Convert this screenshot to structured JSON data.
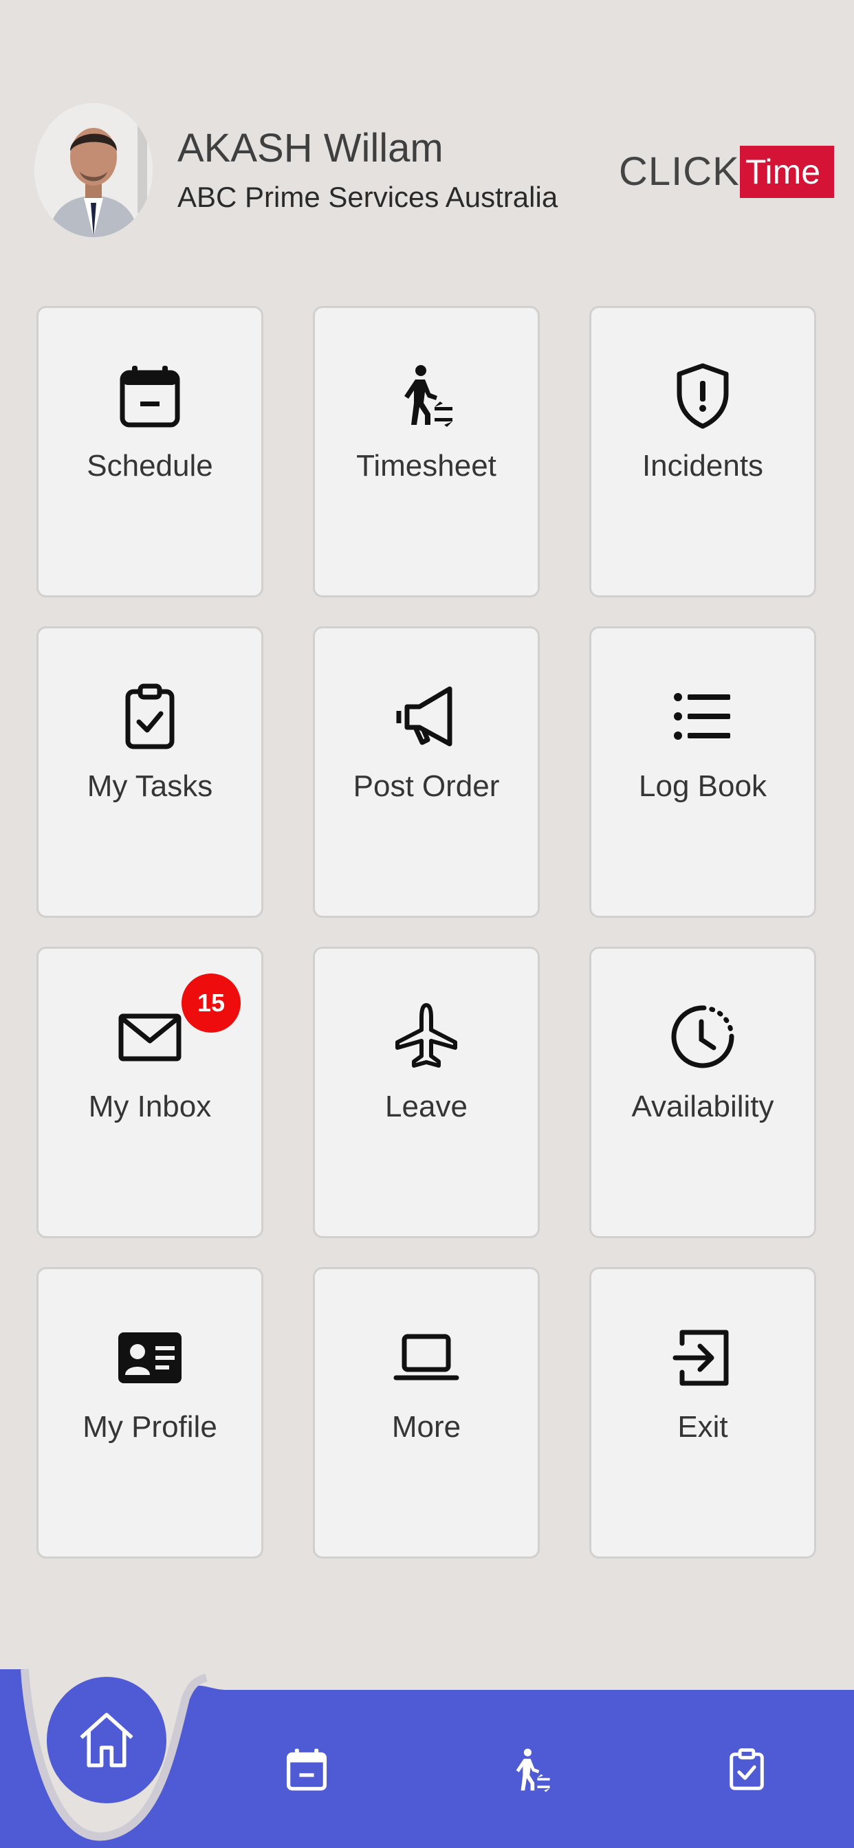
{
  "user": {
    "name": "AKASH Willam",
    "company": "ABC Prime Services Australia"
  },
  "logo": {
    "click": "CLICK",
    "time": "Time"
  },
  "tiles": [
    {
      "label": "Schedule",
      "icon": "calendar-icon"
    },
    {
      "label": "Timesheet",
      "icon": "walking-transfer-icon"
    },
    {
      "label": "Incidents",
      "icon": "shield-alert-icon"
    },
    {
      "label": "My Tasks",
      "icon": "clipboard-check-icon"
    },
    {
      "label": "Post Order",
      "icon": "megaphone-icon"
    },
    {
      "label": "Log Book",
      "icon": "list-icon"
    },
    {
      "label": "My Inbox",
      "icon": "envelope-icon",
      "badge": "15"
    },
    {
      "label": "Leave",
      "icon": "airplane-icon"
    },
    {
      "label": "Availability",
      "icon": "clock-history-icon"
    },
    {
      "label": "My Profile",
      "icon": "id-card-icon"
    },
    {
      "label": "More",
      "icon": "laptop-icon"
    },
    {
      "label": "Exit",
      "icon": "exit-icon"
    }
  ],
  "bottom_nav": [
    {
      "name": "home",
      "icon": "home-icon",
      "active": true
    },
    {
      "name": "schedule",
      "icon": "calendar-icon"
    },
    {
      "name": "timesheet",
      "icon": "walking-transfer-icon"
    },
    {
      "name": "tasks",
      "icon": "clipboard-check-icon"
    }
  ],
  "colors": {
    "background": "#e4e1df",
    "tile": "#f3f2f3",
    "accent_red": "#d41336",
    "badge_red": "#ee0c0c",
    "nav_blue": "#4f5bd5"
  }
}
